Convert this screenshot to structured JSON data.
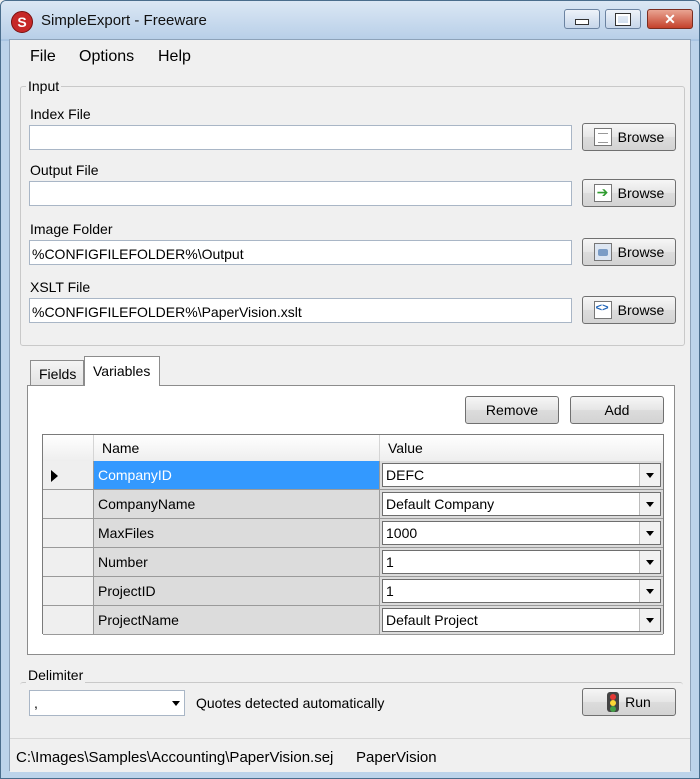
{
  "window": {
    "title": "SimpleExport - Freeware",
    "app_icon": "S"
  },
  "menu": {
    "file": "File",
    "options": "Options",
    "help": "Help"
  },
  "input": {
    "group_label": "Input",
    "index_file": {
      "label": "Index File",
      "value": "",
      "button": "Browse"
    },
    "output_file": {
      "label": "Output File",
      "value": "",
      "button": "Browse"
    },
    "image_folder": {
      "label": "Image Folder",
      "value": "%CONFIGFILEFOLDER%\\Output",
      "button": "Browse"
    },
    "xslt_file": {
      "label": "XSLT File",
      "value": "%CONFIGFILEFOLDER%\\PaperVision.xslt",
      "button": "Browse"
    }
  },
  "tabs": {
    "fields": "Fields",
    "variables": "Variables",
    "active": "Variables"
  },
  "variables": {
    "remove_button": "Remove",
    "add_button": "Add",
    "columns": {
      "name": "Name",
      "value": "Value"
    },
    "rows": [
      {
        "name": "CompanyID",
        "value": "DEFC"
      },
      {
        "name": "CompanyName",
        "value": "Default Company"
      },
      {
        "name": "MaxFiles",
        "value": "1000"
      },
      {
        "name": "Number",
        "value": "1"
      },
      {
        "name": "ProjectID",
        "value": "1"
      },
      {
        "name": "ProjectName",
        "value": "Default Project"
      }
    ]
  },
  "delimiter": {
    "group_label": "Delimiter",
    "value": ",",
    "note": "Quotes detected automatically",
    "run_button": "Run"
  },
  "status": {
    "path": "C:\\Images\\Samples\\Accounting\\PaperVision.sej",
    "label": "PaperVision"
  },
  "icons": {
    "index_browse": "document-icon",
    "output_browse": "arrow-document-icon",
    "image_browse": "folder-icon",
    "xslt_browse": "xml-icon",
    "run": "traffic-light-icon"
  }
}
